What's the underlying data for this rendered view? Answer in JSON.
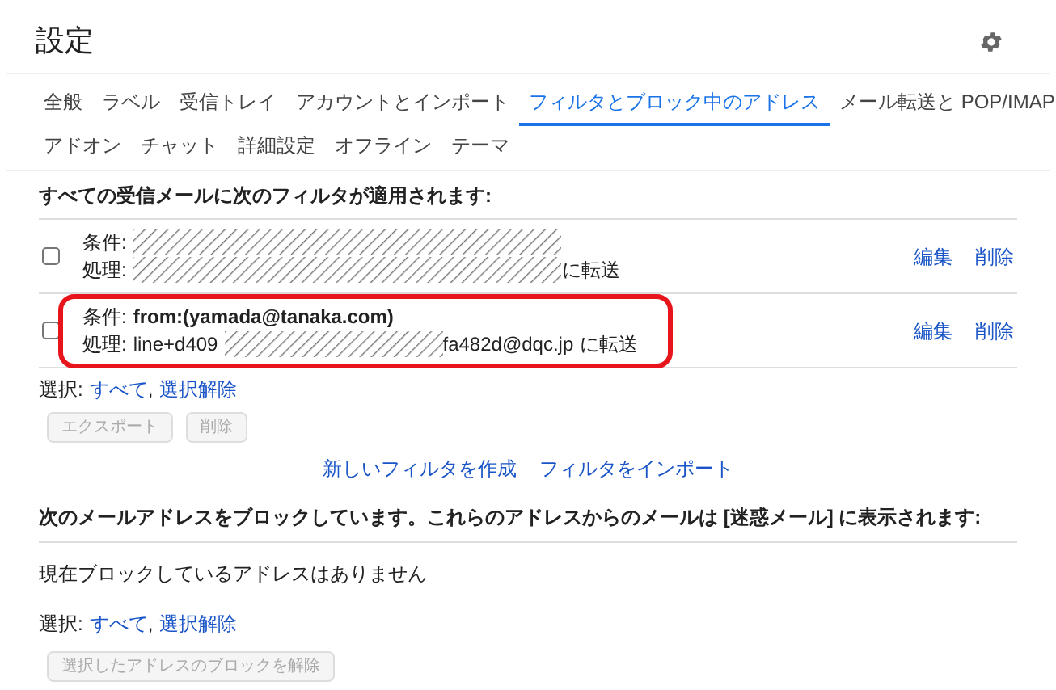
{
  "title": "設定",
  "tabs": [
    {
      "label": "全般",
      "selected": false
    },
    {
      "label": "ラベル",
      "selected": false
    },
    {
      "label": "受信トレイ",
      "selected": false
    },
    {
      "label": "アカウントとインポート",
      "selected": false
    },
    {
      "label": "フィルタとブロック中のアドレス",
      "selected": true
    },
    {
      "label": "メール転送と POP/IMAP",
      "selected": false
    },
    {
      "label": "アドオン",
      "selected": false
    },
    {
      "label": "チャット",
      "selected": false
    },
    {
      "label": "詳細設定",
      "selected": false
    },
    {
      "label": "オフライン",
      "selected": false
    },
    {
      "label": "テーマ",
      "selected": false
    }
  ],
  "filters_heading": "すべての受信メールに次のフィルタが適用されます:",
  "filters": [
    {
      "checked": false,
      "highlighted": false,
      "condition_label": "条件:",
      "condition": [
        {
          "kind": "redacted_long"
        }
      ],
      "action_label": "処理:",
      "action": [
        {
          "kind": "redacted_long"
        },
        {
          "kind": "text",
          "text": "に転送"
        }
      ],
      "edit": "編集",
      "delete": "削除"
    },
    {
      "checked": false,
      "highlighted": true,
      "condition_label": "条件:",
      "condition": [
        {
          "kind": "bold",
          "text": "from:(yamada@tanaka.com)"
        }
      ],
      "action_label": "処理:",
      "action": [
        {
          "kind": "text",
          "text": "line+d409"
        },
        {
          "kind": "redacted_short"
        },
        {
          "kind": "text",
          "text": "fa482d@dqc.jp"
        },
        {
          "kind": "text",
          "text": "に転送"
        }
      ],
      "edit": "編集",
      "delete": "削除"
    }
  ],
  "filter_select": {
    "label": "選択:",
    "all": "すべて",
    "separator": ",",
    "none": "選択解除"
  },
  "filter_buttons": [
    {
      "label": "エクスポート",
      "disabled": true
    },
    {
      "label": "削除",
      "disabled": true
    }
  ],
  "filter_links": [
    "新しいフィルタを作成",
    "フィルタをインポート"
  ],
  "blocked_heading": "次のメールアドレスをブロックしています。これらのアドレスからのメールは [迷惑メール] に表示されます:",
  "blocked_empty": "現在ブロックしているアドレスはありません",
  "blocked_select": {
    "label": "選択:",
    "all": "すべて",
    "separator": ",",
    "none": "選択解除"
  },
  "blocked_button": {
    "label": "選択したアドレスのブロックを解除",
    "disabled": true
  }
}
